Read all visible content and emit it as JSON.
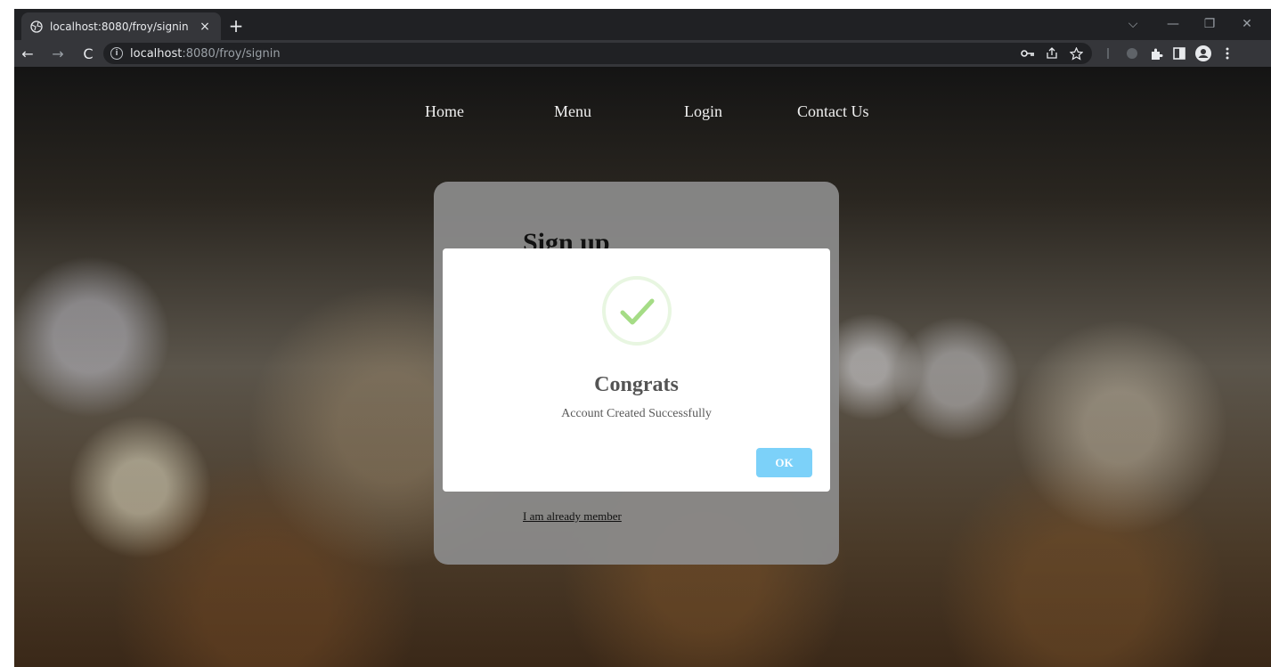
{
  "browser": {
    "tab_title": "localhost:8080/froy/signin",
    "tab_close": "×",
    "new_tab": "+",
    "url_host": "localhost",
    "url_path": ":8080/froy/signin",
    "back": "←",
    "forward": "→",
    "reload": "C",
    "info": "i",
    "win_minimize": "—",
    "win_restore": "❐",
    "win_close": "✕",
    "win_dropdown": "⌵"
  },
  "nav": {
    "items": [
      "Home",
      "Menu",
      "Login",
      "Contact Us"
    ]
  },
  "signup_card": {
    "title": "Sign up",
    "already_member_link": "I am already member"
  },
  "modal": {
    "title": "Congrats",
    "message": "Account Created Successfully",
    "ok_label": "OK",
    "check_color": "#a5dc86",
    "button_color": "#7cd1f9"
  }
}
